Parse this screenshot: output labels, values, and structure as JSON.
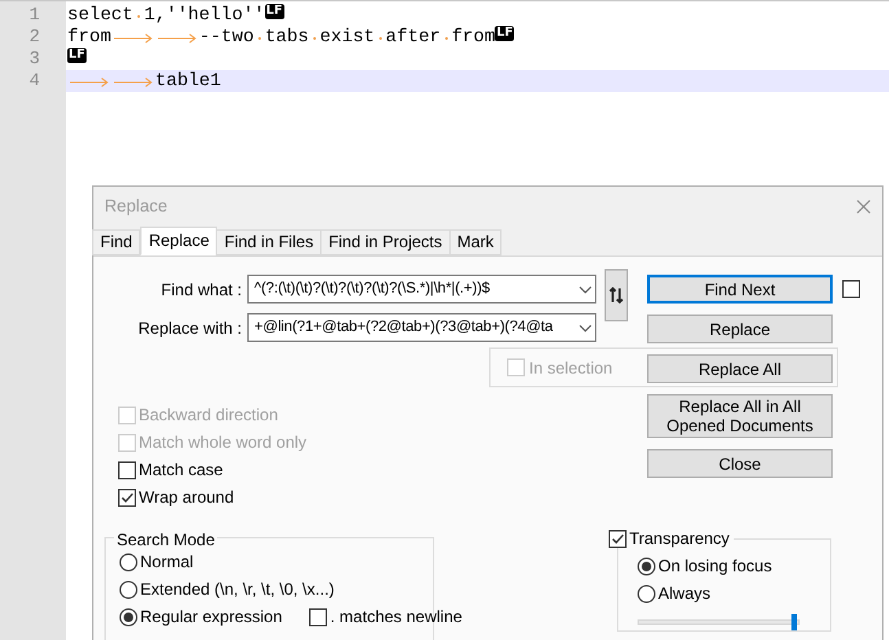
{
  "editor": {
    "lines": [
      {
        "number": "1",
        "current": false,
        "segments": [
          {
            "kind": "text",
            "text": "select"
          },
          {
            "kind": "space"
          },
          {
            "kind": "text",
            "text": "1,''hello''"
          },
          {
            "kind": "eol",
            "text": "LF"
          }
        ]
      },
      {
        "number": "2",
        "current": false,
        "segments": [
          {
            "kind": "text",
            "text": "from"
          },
          {
            "kind": "tab"
          },
          {
            "kind": "tab"
          },
          {
            "kind": "text",
            "text": "--two"
          },
          {
            "kind": "space"
          },
          {
            "kind": "text",
            "text": "tabs"
          },
          {
            "kind": "space"
          },
          {
            "kind": "text",
            "text": "exist"
          },
          {
            "kind": "space"
          },
          {
            "kind": "text",
            "text": "after"
          },
          {
            "kind": "space"
          },
          {
            "kind": "text",
            "text": "from"
          },
          {
            "kind": "eol",
            "text": "LF"
          }
        ]
      },
      {
        "number": "3",
        "current": false,
        "segments": [
          {
            "kind": "eol",
            "text": "LF"
          }
        ]
      },
      {
        "number": "4",
        "current": true,
        "segments": [
          {
            "kind": "tab"
          },
          {
            "kind": "tab"
          },
          {
            "kind": "text",
            "text": "table1"
          }
        ]
      }
    ]
  },
  "dialog": {
    "title": "Replace",
    "tabs": [
      {
        "label": "Find",
        "selected": false
      },
      {
        "label": "Replace",
        "selected": true
      },
      {
        "label": "Find in Files",
        "selected": false
      },
      {
        "label": "Find in Projects",
        "selected": false
      },
      {
        "label": "Mark",
        "selected": false
      }
    ],
    "fields": [
      {
        "label": "Find what :",
        "value": "^(?:(\\t)(\\t)?(\\t)?(\\t)?(\\t)?(\\S.*)|\\h*|(.+))$"
      },
      {
        "label": "Replace with :",
        "value": "+@lin(?1+@tab+(?2@tab+)(?3@tab+)(?4@ta"
      }
    ],
    "buttons": [
      {
        "label": "Find Next",
        "focused": true
      },
      {
        "label": "Replace",
        "focused": false
      },
      {
        "label": "Replace All",
        "focused": false
      },
      {
        "label": "Replace All in All Opened Documents",
        "focused": false
      },
      {
        "label": "Close",
        "focused": false
      }
    ],
    "side_checkbox": {
      "checked": false
    },
    "in_selection": {
      "label": "In selection",
      "checked": false,
      "disabled": true
    },
    "options": [
      {
        "label": "Backward direction",
        "checked": false,
        "disabled": true
      },
      {
        "label": "Match whole word only",
        "checked": false,
        "disabled": true
      },
      {
        "label": "Match case",
        "checked": false,
        "disabled": false
      },
      {
        "label": "Wrap around",
        "checked": true,
        "disabled": false
      }
    ],
    "search_mode": {
      "title": "Search Mode",
      "options": [
        {
          "label": "Normal",
          "selected": false
        },
        {
          "label": "Extended (\\n, \\r, \\t, \\0, \\x...)",
          "selected": false
        },
        {
          "label": "Regular expression",
          "selected": true
        }
      ],
      "matches_newline": {
        "label": ". matches newline",
        "checked": false
      }
    },
    "transparency": {
      "label": "Transparency",
      "checked": true,
      "options": [
        {
          "label": "On losing focus",
          "selected": true
        },
        {
          "label": "Always",
          "selected": false
        }
      ],
      "level": 0.97
    }
  }
}
